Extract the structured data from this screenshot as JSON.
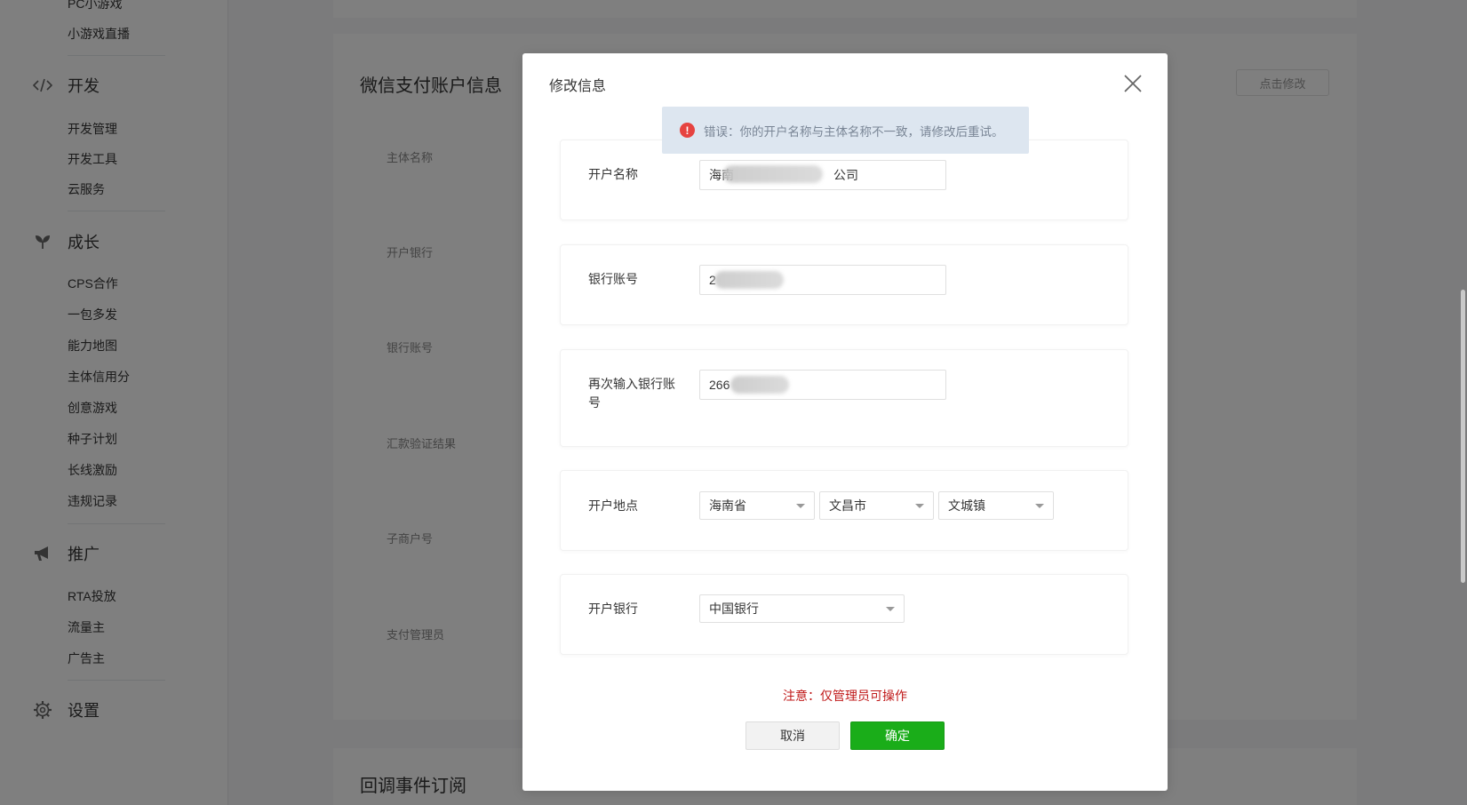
{
  "sidebar": {
    "top_items": [
      "PC小游戏",
      "小游戏直播"
    ],
    "sections": [
      {
        "label": "开发",
        "icon": "code-icon",
        "items": [
          "开发管理",
          "开发工具",
          "云服务"
        ]
      },
      {
        "label": "成长",
        "icon": "sprout-icon",
        "items": [
          "CPS合作",
          "一包多发",
          "能力地图",
          "主体信用分",
          "创意游戏",
          "种子计划",
          "长线激励",
          "违规记录"
        ]
      },
      {
        "label": "推广",
        "icon": "megaphone-icon",
        "items": [
          "RTA投放",
          "流量主",
          "广告主"
        ]
      },
      {
        "label": "设置",
        "icon": "gear-icon",
        "items": []
      }
    ]
  },
  "background": {
    "section_title": "微信支付账户信息",
    "edit_button": "点击修改",
    "labels": [
      "主体名称",
      "开户银行",
      "银行账号",
      "汇款验证结果",
      "子商户号",
      "支付管理员"
    ],
    "next_section_title": "回调事件订阅"
  },
  "dialog": {
    "title": "修改信息",
    "error": "错误：你的开户名称与主体名称不一致，请修改后重试。",
    "fields": {
      "account_name": {
        "label": "开户名称",
        "value_start": "海南",
        "value_end": "公司"
      },
      "bank_account": {
        "label": "银行账号",
        "value": "2"
      },
      "bank_account_confirm": {
        "label": "再次输入银行账号",
        "value": "266"
      },
      "location": {
        "label": "开户地点",
        "province": "海南省",
        "city": "文昌市",
        "town": "文城镇"
      },
      "bank": {
        "label": "开户银行",
        "value": "中国银行"
      }
    },
    "notice": "注意：仅管理员可操作",
    "cancel": "取消",
    "confirm": "确定"
  },
  "colors": {
    "primary": "#1aad19",
    "error": "#e64340",
    "notice": "#c01a1a"
  }
}
